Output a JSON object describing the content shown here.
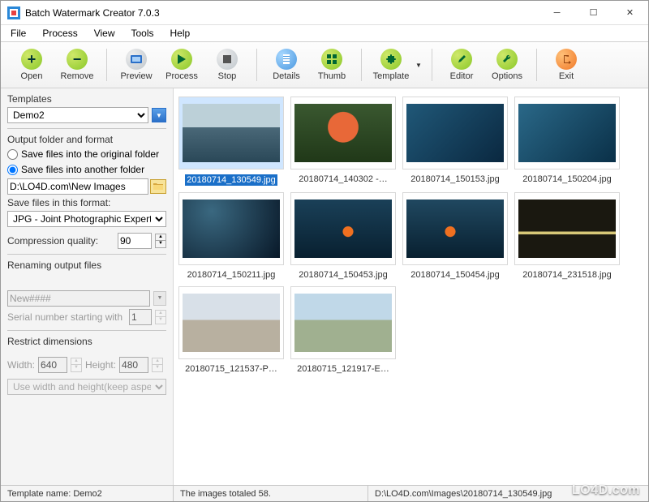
{
  "window": {
    "title": "Batch Watermark Creator 7.0.3"
  },
  "menubar": [
    "File",
    "Process",
    "View",
    "Tools",
    "Help"
  ],
  "toolbar": {
    "open": "Open",
    "remove": "Remove",
    "preview": "Preview",
    "process": "Process",
    "stop": "Stop",
    "details": "Details",
    "thumb": "Thumb",
    "template": "Template",
    "editor": "Editor",
    "options": "Options",
    "exit": "Exit"
  },
  "sidebar": {
    "templates_label": "Templates",
    "template_selected": "Demo2",
    "output_hdr": "Output folder and format",
    "radio_original": "Save files into the original folder",
    "radio_another": "Save files into another folder",
    "output_path": "D:\\LO4D.com\\New Images",
    "format_label": "Save files in this format:",
    "format_selected": "JPG - Joint Photographic Experts (",
    "compression_label": "Compression quality:",
    "compression_value": "90",
    "rename_hdr": "Renaming output files",
    "rename_pattern": "New####",
    "serial_label": "Serial number starting with",
    "serial_value": "1",
    "restrict_hdr": "Restrict dimensions",
    "width_label": "Width:",
    "width_value": "640",
    "height_label": "Height:",
    "height_value": "480",
    "aspect_selected": "Use width and height(keep aspect"
  },
  "thumbs": [
    {
      "caption": "20180714_130549.jpg",
      "sel": true,
      "variant": "dock"
    },
    {
      "caption": "20180714_140302 -…",
      "variant": "starfish"
    },
    {
      "caption": "20180714_150153.jpg",
      "variant": "aqua"
    },
    {
      "caption": "20180714_150204.jpg",
      "variant": "aqua2"
    },
    {
      "caption": "20180714_150211.jpg",
      "variant": "deep"
    },
    {
      "caption": "20180714_150453.jpg",
      "variant": "clown"
    },
    {
      "caption": "20180714_150454.jpg",
      "variant": "clown2"
    },
    {
      "caption": "20180714_231518.jpg",
      "variant": "arch"
    },
    {
      "caption": "20180715_121537-P…",
      "variant": "pano1"
    },
    {
      "caption": "20180715_121917-E…",
      "variant": "pano2"
    }
  ],
  "statusbar": {
    "template_name": "Template name: Demo2",
    "total": "The images totaled 58.",
    "path": "D:\\LO4D.com\\Images\\20180714_130549.jpg"
  },
  "watermark": "LO4D.com"
}
